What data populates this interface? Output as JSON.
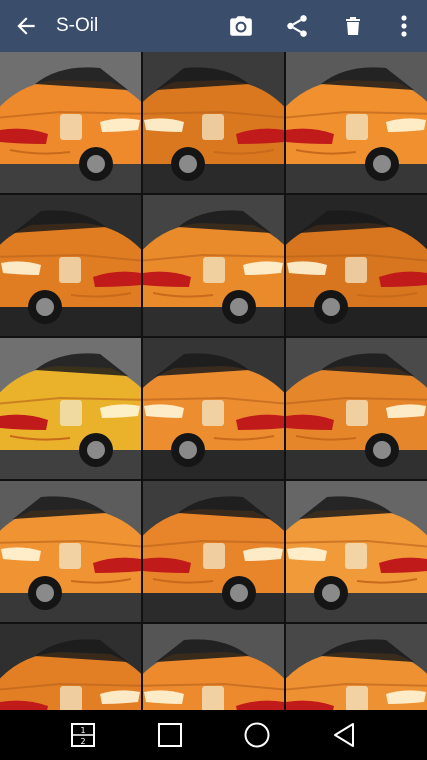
{
  "appbar": {
    "title": "S-Oil",
    "back_icon": "arrow-left-icon",
    "actions": [
      "camera-icon",
      "share-icon",
      "trash-icon",
      "overflow-menu-icon"
    ]
  },
  "colors": {
    "appbar": "#3a4e6b",
    "taxi_orange": "#e8862a",
    "background": "#000000"
  },
  "gallery": {
    "columns": 3,
    "photo_count": 15
  },
  "navbar": {
    "buttons": [
      "dual-window-icon",
      "recents-icon",
      "home-icon",
      "back-triangle-icon"
    ]
  }
}
